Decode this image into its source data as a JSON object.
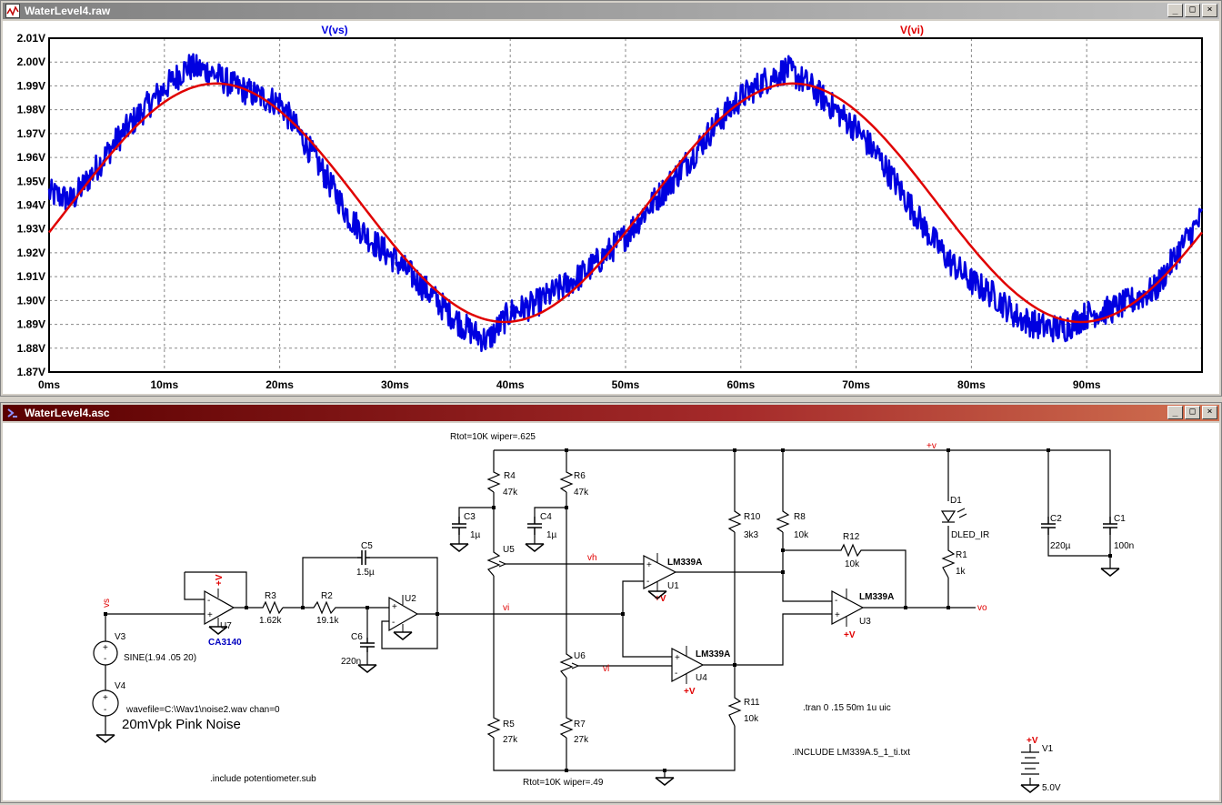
{
  "waveform_window": {
    "title": "WaterLevel4.raw",
    "trace_labels": [
      "V(vs)",
      "V(vi)"
    ],
    "trace_colors": [
      "#0000e0",
      "#e00000"
    ],
    "y_ticks": [
      "2.01V",
      "2.00V",
      "1.99V",
      "1.98V",
      "1.97V",
      "1.96V",
      "1.95V",
      "1.94V",
      "1.93V",
      "1.92V",
      "1.91V",
      "1.90V",
      "1.89V",
      "1.88V",
      "1.87V"
    ],
    "x_ticks": [
      "0ms",
      "10ms",
      "20ms",
      "30ms",
      "40ms",
      "50ms",
      "60ms",
      "70ms",
      "80ms",
      "90ms"
    ]
  },
  "schematic_window": {
    "title": "WaterLevel4.asc",
    "nets": {
      "vs": "vs",
      "vi": "vi",
      "vh": "vh",
      "vl": "vl",
      "vo": "vo",
      "vplus": "+v"
    },
    "refs": {
      "R1": "R1",
      "R2": "R2",
      "R3": "R3",
      "R4": "R4",
      "R5": "R5",
      "R6": "R6",
      "R7": "R7",
      "R8": "R8",
      "R10": "R10",
      "R11": "R11",
      "R12": "R12",
      "C1": "C1",
      "C2": "C2",
      "C3": "C3",
      "C4": "C4",
      "C5": "C5",
      "C6": "C6",
      "U1": "U1",
      "U2": "U2",
      "U3": "U3",
      "U4": "U4",
      "U5": "U5",
      "U6": "U6",
      "U7": "U7",
      "V1": "V1",
      "V3": "V3",
      "V4": "V4",
      "D1": "D1"
    },
    "values": {
      "R1": "1k",
      "R2": "19.1k",
      "R3": "1.62k",
      "R4": "47k",
      "R5": "27k",
      "R6": "47k",
      "R7": "27k",
      "R8": "10k",
      "R10": "3k3",
      "R11": "10k",
      "R12": "10k",
      "C1": "100n",
      "C2": "220µ",
      "C3": "1µ",
      "C4": "1µ",
      "C5": "1.5µ",
      "C6": "220n",
      "U1": "LM339A",
      "U3": "LM339A",
      "U4": "LM339A",
      "U7": "CA3140",
      "D1": "DLED_IR",
      "V1": "5.0V",
      "V3": "SINE(1.94 .05 20)"
    },
    "directives": {
      "rtot_top": "Rtot=10K wiper=.625",
      "rtot_bottom": "Rtot=10K wiper=.49",
      "wavefile": "wavefile=C:\\Wav1\\noise2.wav chan=0",
      "pink_noise": "20mVpk Pink Noise",
      "include_pot": ".include potentiometer.sub",
      "tran": ".tran 0 .15 50m 1u uic",
      "include_lm339": ".INCLUDE LM339A.5_1_ti.txt"
    }
  },
  "chart_data": {
    "type": "line",
    "title": "",
    "xlabel": "",
    "ylabel": "",
    "x_unit": "ms",
    "xlim": [
      0,
      100
    ],
    "ylim": [
      1.87,
      2.01
    ],
    "grid": true,
    "series": [
      {
        "name": "V(vs)",
        "color": "#0000e0",
        "x": [
          0,
          2,
          4,
          6,
          8,
          10,
          12,
          14,
          16,
          18,
          20,
          22,
          24,
          26,
          28,
          30,
          32,
          34,
          36,
          38,
          40,
          42,
          44,
          46,
          48,
          50,
          52,
          54,
          56,
          58,
          60,
          62,
          64,
          66,
          68,
          70,
          72,
          74,
          76,
          78,
          80,
          82,
          84,
          86,
          88,
          90,
          92,
          94,
          96,
          98,
          100
        ],
        "y": [
          1.945,
          1.942,
          1.955,
          1.968,
          1.979,
          1.989,
          1.998,
          1.996,
          1.99,
          1.986,
          1.983,
          1.968,
          1.952,
          1.935,
          1.925,
          1.917,
          1.908,
          1.898,
          1.889,
          1.883,
          1.895,
          1.898,
          1.904,
          1.91,
          1.918,
          1.927,
          1.939,
          1.95,
          1.962,
          1.975,
          1.985,
          1.992,
          1.997,
          1.99,
          1.981,
          1.972,
          1.96,
          1.945,
          1.93,
          1.917,
          1.908,
          1.902,
          1.893,
          1.889,
          1.888,
          1.894,
          1.896,
          1.9,
          1.905,
          1.921,
          1.935
        ]
      },
      {
        "name": "V(vi)",
        "color": "#e00000",
        "sine": {
          "offset": 1.941,
          "amplitude": 0.05,
          "freq_hz": 20,
          "delay_ms": 2.0
        }
      }
    ]
  }
}
